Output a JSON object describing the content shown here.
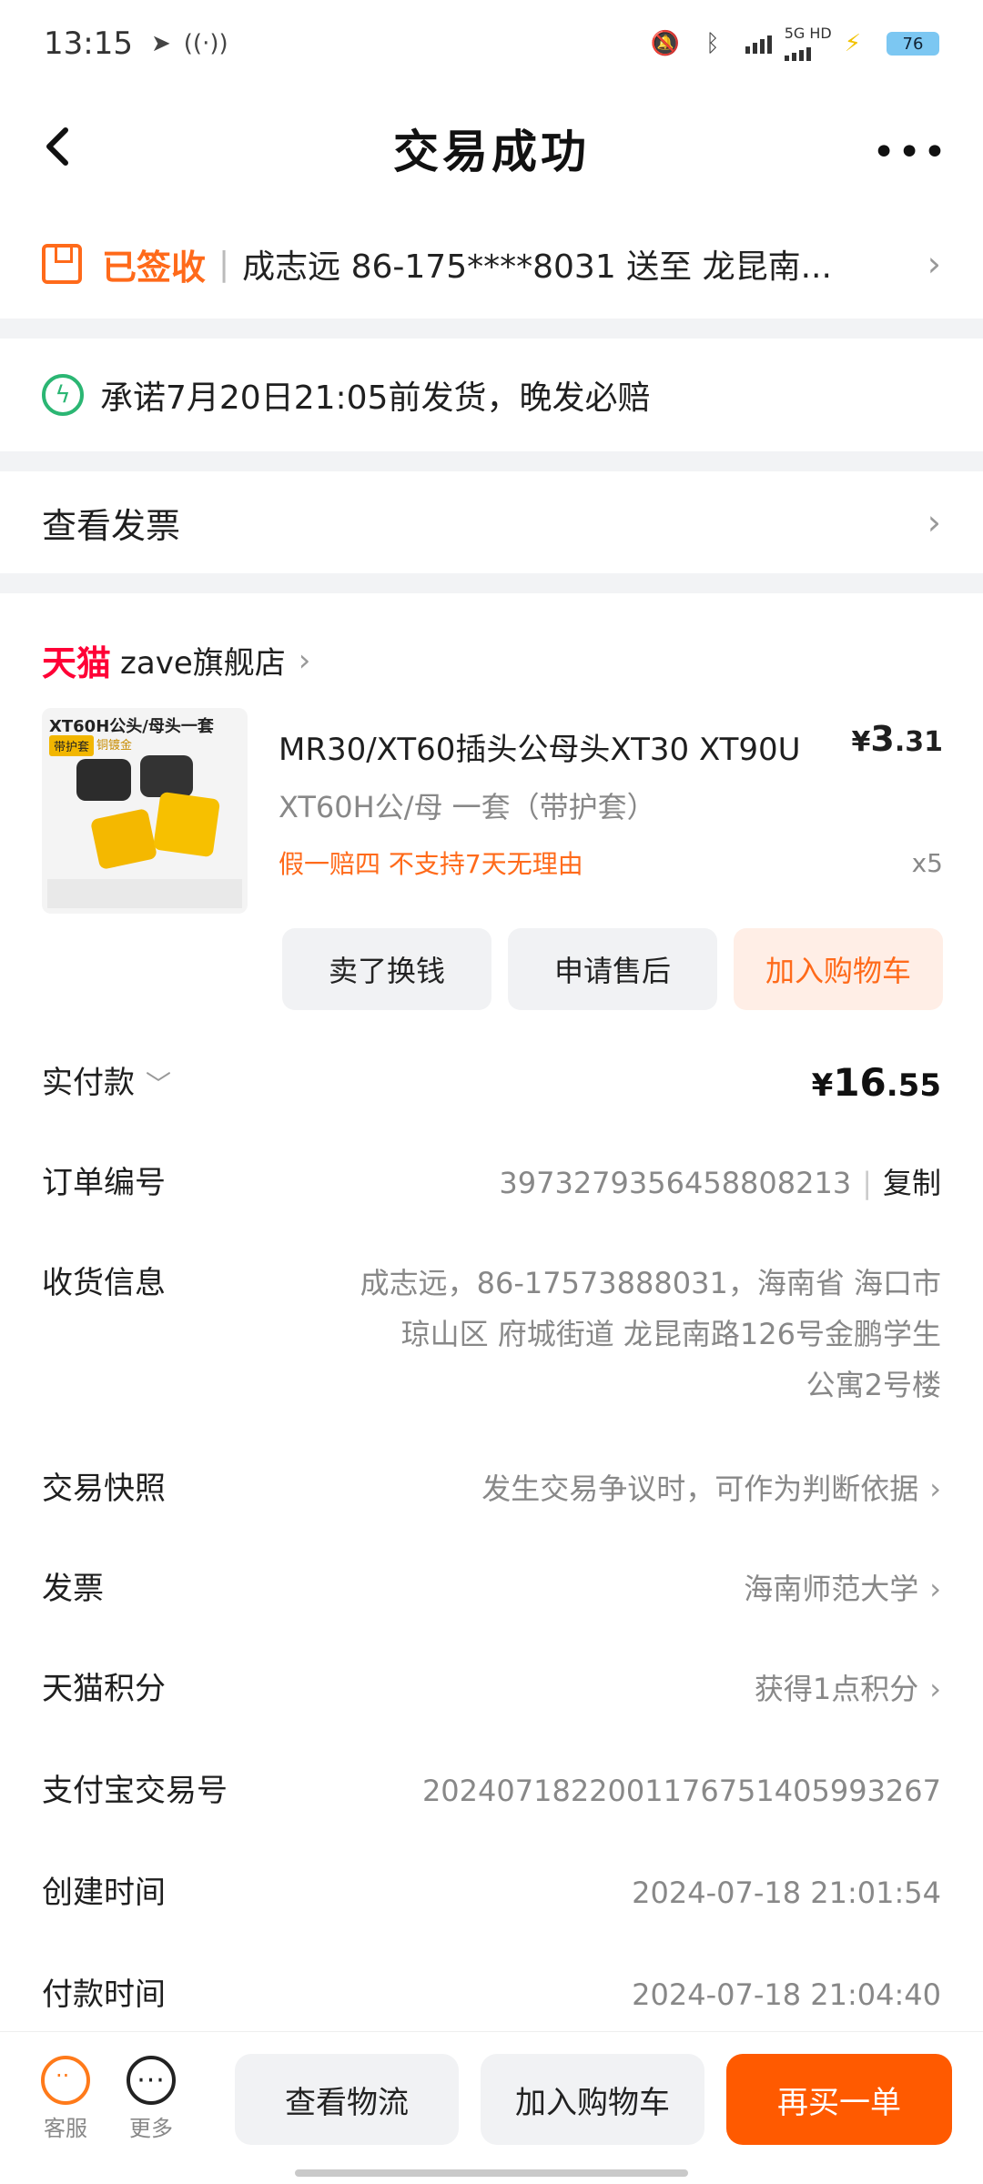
{
  "status_bar": {
    "time": "13:15",
    "network": "5G HD",
    "battery": "76"
  },
  "header": {
    "title": "交易成功"
  },
  "delivery": {
    "status": "已签收",
    "address": "成志远 86-175****8031 送至 龙昆南..."
  },
  "promise": {
    "text": "承诺7月20日21:05前发货，晚发必赔"
  },
  "invoice_row": {
    "label": "查看发票"
  },
  "shop": {
    "platform": "天猫",
    "name": "zave旗舰店"
  },
  "product": {
    "image_title": "XT60H公头/母头一套",
    "image_tag": "带护套",
    "image_tag2": "铜镀金",
    "title": "MR30/XT60插头公母头XT30 XT90U",
    "price_symbol": "¥",
    "price_int": "3",
    "price_dec": ".31",
    "sku": "XT60H公/母 一套（带护套）",
    "promo": "假一赔四  不支持7天无理由",
    "qty": "x5"
  },
  "actions": {
    "sell": "卖了换钱",
    "after_sale": "申请售后",
    "add_cart": "加入购物车"
  },
  "details": {
    "paid_label": "实付款",
    "paid_symbol": "¥",
    "paid_int": "16",
    "paid_dec": ".55",
    "order_no_label": "订单编号",
    "order_no": "3973279356458808213",
    "copy": "复制",
    "recv_label": "收货信息",
    "recv_line1": "成志远，86-17573888031，海南省 海口市",
    "recv_line2": "琼山区 府城街道 龙昆南路126号金鹏学生",
    "recv_line3": "公寓2号楼",
    "snapshot_label": "交易快照",
    "snapshot_value": "发生交易争议时，可作为判断依据",
    "invoice_label": "发票",
    "invoice_value": "海南师范大学",
    "points_label": "天猫积分",
    "points_value": "获得1点积分",
    "alipay_label": "支付宝交易号",
    "alipay_value": "2024071822001176751405993267",
    "created_label": "创建时间",
    "created_value": "2024-07-18 21:01:54",
    "paid_time_label": "付款时间",
    "paid_time_value": "2024-07-18 21:04:40"
  },
  "bottom": {
    "service": "客服",
    "more": "更多",
    "logistics": "查看物流",
    "add_cart": "加入购物车",
    "rebuy": "再买一单"
  }
}
